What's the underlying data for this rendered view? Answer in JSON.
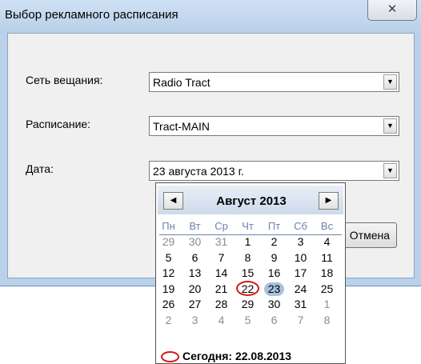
{
  "window": {
    "title": "Выбор рекламного расписания",
    "close_glyph": "✕"
  },
  "form": {
    "network_label": "Сеть вещания:",
    "network_value": "Radio Tract",
    "schedule_label": "Расписание:",
    "schedule_value": "Tract-MAIN",
    "date_label": "Дата:",
    "date_value": "23  августа  2013 г.",
    "dropdown_glyph": "▼",
    "cancel_label": "Отмена"
  },
  "calendar": {
    "month_title": "Август 2013",
    "prev_glyph": "◀",
    "next_glyph": "▶",
    "weekdays": [
      "Пн",
      "Вт",
      "Ср",
      "Чт",
      "Пт",
      "Сб",
      "Вс"
    ],
    "weeks": [
      [
        {
          "d": "29",
          "o": true
        },
        {
          "d": "30",
          "o": true
        },
        {
          "d": "31",
          "o": true
        },
        {
          "d": "1"
        },
        {
          "d": "2"
        },
        {
          "d": "3"
        },
        {
          "d": "4"
        }
      ],
      [
        {
          "d": "5"
        },
        {
          "d": "6"
        },
        {
          "d": "7"
        },
        {
          "d": "8"
        },
        {
          "d": "9"
        },
        {
          "d": "10"
        },
        {
          "d": "11"
        }
      ],
      [
        {
          "d": "12"
        },
        {
          "d": "13"
        },
        {
          "d": "14"
        },
        {
          "d": "15"
        },
        {
          "d": "16"
        },
        {
          "d": "17"
        },
        {
          "d": "18"
        }
      ],
      [
        {
          "d": "19"
        },
        {
          "d": "20"
        },
        {
          "d": "21"
        },
        {
          "d": "22",
          "today": true
        },
        {
          "d": "23",
          "selected": true
        },
        {
          "d": "24"
        },
        {
          "d": "25"
        }
      ],
      [
        {
          "d": "26"
        },
        {
          "d": "27"
        },
        {
          "d": "28"
        },
        {
          "d": "29"
        },
        {
          "d": "30"
        },
        {
          "d": "31"
        },
        {
          "d": "1",
          "o": true
        }
      ],
      [
        {
          "d": "2",
          "o": true
        },
        {
          "d": "3",
          "o": true
        },
        {
          "d": "4",
          "o": true
        },
        {
          "d": "5",
          "o": true
        },
        {
          "d": "6",
          "o": true
        },
        {
          "d": "7",
          "o": true
        },
        {
          "d": "8",
          "o": true
        }
      ]
    ],
    "today_label": "Сегодня: 22.08.2013",
    "colors": {
      "today_circle": "#d11a1a",
      "selected": "#a8c2dc",
      "weekday": "#6a82b0"
    }
  }
}
